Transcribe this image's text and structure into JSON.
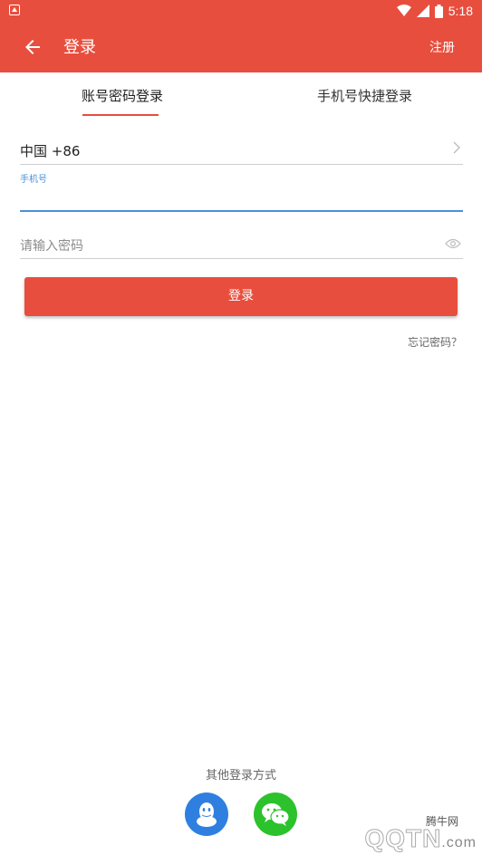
{
  "status_bar": {
    "time": "5:18"
  },
  "app_bar": {
    "title": "登录",
    "register_label": "注册"
  },
  "tabs": [
    {
      "label": "账号密码登录",
      "active": true
    },
    {
      "label": "手机号快捷登录",
      "active": false
    }
  ],
  "form": {
    "country_code": "中国 +86",
    "phone_label": "手机号",
    "password_placeholder": "请输入密码",
    "login_label": "登录",
    "forgot_label": "忘记密码？"
  },
  "other_login": {
    "title": "其他登录方式",
    "providers": [
      {
        "icon": "qq-icon",
        "color": "#2f7fe0"
      },
      {
        "icon": "wechat-icon",
        "color": "#2cc22c"
      }
    ]
  },
  "watermark": {
    "site": "腾牛网",
    "logo": "QQTN",
    "suffix": ".com"
  },
  "colors": {
    "accent": "#e84e3d",
    "focus": "#4a90d9"
  }
}
